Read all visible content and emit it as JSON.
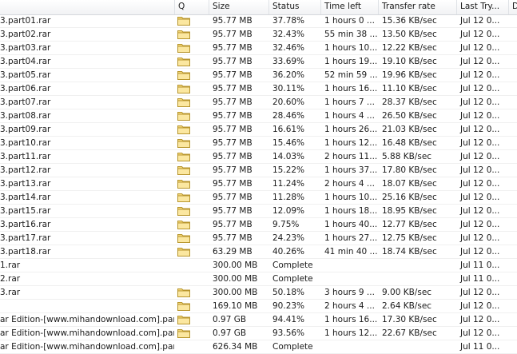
{
  "columns": {
    "name": "",
    "q": "Q",
    "size": "Size",
    "status": "Status",
    "time_left": "Time left",
    "transfer_rate": "Transfer rate",
    "last_try": "Last Try...",
    "d": "D"
  },
  "rows": [
    {
      "name": "3.part01.rar",
      "q": true,
      "size": "95.77  MB",
      "status": "37.78%",
      "time_left": "1 hours 0 ...",
      "rate": "15.36  KB/sec",
      "last_try": "Jul 12 0..."
    },
    {
      "name": "3.part02.rar",
      "q": true,
      "size": "95.77  MB",
      "status": "32.43%",
      "time_left": "55 min 38 ...",
      "rate": "13.50  KB/sec",
      "last_try": "Jul 12 0..."
    },
    {
      "name": "3.part03.rar",
      "q": true,
      "size": "95.77  MB",
      "status": "32.46%",
      "time_left": "1 hours 10...",
      "rate": "12.22  KB/sec",
      "last_try": "Jul 12 0..."
    },
    {
      "name": "3.part04.rar",
      "q": true,
      "size": "95.77  MB",
      "status": "33.69%",
      "time_left": "1 hours 19...",
      "rate": "19.10  KB/sec",
      "last_try": "Jul 12 0..."
    },
    {
      "name": "3.part05.rar",
      "q": true,
      "size": "95.77  MB",
      "status": "36.20%",
      "time_left": "52 min 59 ...",
      "rate": "19.96  KB/sec",
      "last_try": "Jul 12 0..."
    },
    {
      "name": "3.part06.rar",
      "q": true,
      "size": "95.77  MB",
      "status": "30.11%",
      "time_left": "1 hours 16...",
      "rate": "11.10  KB/sec",
      "last_try": "Jul 12 0..."
    },
    {
      "name": "3.part07.rar",
      "q": true,
      "size": "95.77  MB",
      "status": "20.60%",
      "time_left": "1 hours 7 ...",
      "rate": "28.37  KB/sec",
      "last_try": "Jul 12 0..."
    },
    {
      "name": "3.part08.rar",
      "q": true,
      "size": "95.77  MB",
      "status": "28.46%",
      "time_left": "1 hours 4 ...",
      "rate": "26.50  KB/sec",
      "last_try": "Jul 12 0..."
    },
    {
      "name": "3.part09.rar",
      "q": true,
      "size": "95.77  MB",
      "status": "16.61%",
      "time_left": "1 hours 26...",
      "rate": "21.03  KB/sec",
      "last_try": "Jul 12 0..."
    },
    {
      "name": "3.part10.rar",
      "q": true,
      "size": "95.77  MB",
      "status": "15.46%",
      "time_left": "1 hours 12...",
      "rate": "16.48  KB/sec",
      "last_try": "Jul 12 0..."
    },
    {
      "name": "3.part11.rar",
      "q": true,
      "size": "95.77  MB",
      "status": "14.03%",
      "time_left": "2 hours 11...",
      "rate": "5.88  KB/sec",
      "last_try": "Jul 12 0..."
    },
    {
      "name": "3.part12.rar",
      "q": true,
      "size": "95.77  MB",
      "status": "15.22%",
      "time_left": "1 hours 37...",
      "rate": "17.80  KB/sec",
      "last_try": "Jul 12 0..."
    },
    {
      "name": "3.part13.rar",
      "q": true,
      "size": "95.77  MB",
      "status": "11.24%",
      "time_left": "2 hours 4 ...",
      "rate": "18.07  KB/sec",
      "last_try": "Jul 12 0..."
    },
    {
      "name": "3.part14.rar",
      "q": true,
      "size": "95.77  MB",
      "status": "11.28%",
      "time_left": "1 hours 10...",
      "rate": "25.16  KB/sec",
      "last_try": "Jul 12 0..."
    },
    {
      "name": "3.part15.rar",
      "q": true,
      "size": "95.77  MB",
      "status": "12.09%",
      "time_left": "1 hours 18...",
      "rate": "18.95  KB/sec",
      "last_try": "Jul 12 0..."
    },
    {
      "name": "3.part16.rar",
      "q": true,
      "size": "95.77  MB",
      "status": "9.75%",
      "time_left": "1 hours 40...",
      "rate": "12.77  KB/sec",
      "last_try": "Jul 12 0..."
    },
    {
      "name": "3.part17.rar",
      "q": true,
      "size": "95.77  MB",
      "status": "24.23%",
      "time_left": "1 hours 27...",
      "rate": "12.75  KB/sec",
      "last_try": "Jul 12 0..."
    },
    {
      "name": "3.part18.rar",
      "q": true,
      "size": "63.29  MB",
      "status": "40.26%",
      "time_left": "41 min 40 ...",
      "rate": "18.74  KB/sec",
      "last_try": "Jul 12 0..."
    },
    {
      "name": "1.rar",
      "q": false,
      "size": "300.00  MB",
      "status": "Complete",
      "time_left": "",
      "rate": "",
      "last_try": "Jul 11 0..."
    },
    {
      "name": "2.rar",
      "q": false,
      "size": "300.00  MB",
      "status": "Complete",
      "time_left": "",
      "rate": "",
      "last_try": "Jul 11 0..."
    },
    {
      "name": "3.rar",
      "q": true,
      "size": "300.00  MB",
      "status": "50.18%",
      "time_left": "3 hours 9 ...",
      "rate": "9.00  KB/sec",
      "last_try": "Jul 12 0..."
    },
    {
      "name": "",
      "q": true,
      "size": "169.10  MB",
      "status": "90.23%",
      "time_left": "2 hours 4 ...",
      "rate": "2.64  KB/sec",
      "last_try": "Jul 12 0..."
    },
    {
      "name": "ar Edition-[www.mihandownload.com].part...",
      "q": true,
      "size": "0.97  GB",
      "status": "94.41%",
      "time_left": "1 hours 16...",
      "rate": "17.30  KB/sec",
      "last_try": "Jul 12 0..."
    },
    {
      "name": "ar Edition-[www.mihandownload.com].part...",
      "q": true,
      "size": "0.97  GB",
      "status": "93.56%",
      "time_left": "1 hours 12...",
      "rate": "22.67  KB/sec",
      "last_try": "Jul 12 0..."
    },
    {
      "name": "ar Edition-[www.mihandownload.com].part...",
      "q": false,
      "size": "626.34  MB",
      "status": "Complete",
      "time_left": "",
      "rate": "",
      "last_try": "Jul 11 0..."
    }
  ]
}
